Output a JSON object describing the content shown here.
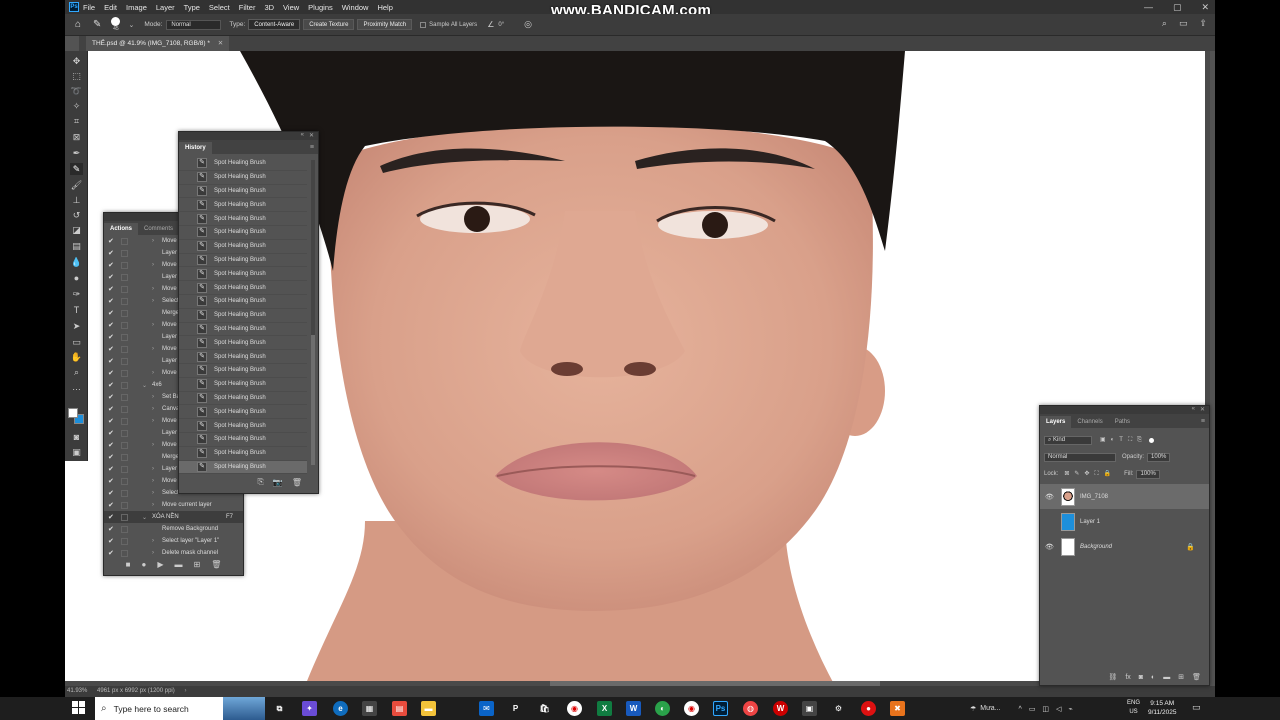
{
  "watermark": "www.BANDICAM.com",
  "menu": [
    "File",
    "Edit",
    "Image",
    "Layer",
    "Type",
    "Select",
    "Filter",
    "3D",
    "View",
    "Plugins",
    "Window",
    "Help"
  ],
  "options": {
    "brush_size": "45",
    "mode_label": "Mode:",
    "mode_value": "Normal",
    "type_label": "Type:",
    "type_buttons": [
      "Content-Aware",
      "Create Texture",
      "Proximity Match"
    ],
    "sample_all_layers": "Sample All Layers",
    "angle_value": "0°"
  },
  "document_tab": "THẺ.psd @ 41.9% (IMG_7108, RGB/8) *",
  "history": {
    "title": "History",
    "items": [
      "Spot Healing Brush",
      "Spot Healing Brush",
      "Spot Healing Brush",
      "Spot Healing Brush",
      "Spot Healing Brush",
      "Spot Healing Brush",
      "Spot Healing Brush",
      "Spot Healing Brush",
      "Spot Healing Brush",
      "Spot Healing Brush",
      "Spot Healing Brush",
      "Spot Healing Brush",
      "Spot Healing Brush",
      "Spot Healing Brush",
      "Spot Healing Brush",
      "Spot Healing Brush",
      "Spot Healing Brush",
      "Spot Healing Brush",
      "Spot Healing Brush",
      "Spot Healing Brush",
      "Spot Healing Brush",
      "Spot Healing Brush",
      "Spot Healing Brush"
    ]
  },
  "actions": {
    "tabs": [
      "Actions",
      "Comments"
    ],
    "rows": [
      {
        "label": "Move",
        "indent": 2,
        "tri": true
      },
      {
        "label": "Layer",
        "indent": 2,
        "tri": false
      },
      {
        "label": "Move",
        "indent": 2,
        "tri": true
      },
      {
        "label": "Layer",
        "indent": 2,
        "tri": false
      },
      {
        "label": "Move",
        "indent": 2,
        "tri": true
      },
      {
        "label": "Select",
        "indent": 2,
        "tri": true
      },
      {
        "label": "Merge",
        "indent": 2,
        "tri": false
      },
      {
        "label": "Move",
        "indent": 2,
        "tri": true
      },
      {
        "label": "Layer",
        "indent": 2,
        "tri": false
      },
      {
        "label": "Move",
        "indent": 2,
        "tri": true
      },
      {
        "label": "Layer",
        "indent": 2,
        "tri": false
      },
      {
        "label": "Move",
        "indent": 2,
        "tri": true
      },
      {
        "label": "4x6",
        "indent": 1,
        "tri": true,
        "open": true
      },
      {
        "label": "Set Ba",
        "indent": 2,
        "tri": true
      },
      {
        "label": "Canva",
        "indent": 2,
        "tri": true
      },
      {
        "label": "Move",
        "indent": 2,
        "tri": true
      },
      {
        "label": "Layer",
        "indent": 2,
        "tri": false
      },
      {
        "label": "Move",
        "indent": 2,
        "tri": true
      },
      {
        "label": "Merge",
        "indent": 2,
        "tri": false
      },
      {
        "label": "Layer",
        "indent": 2,
        "tri": true
      },
      {
        "label": "Move",
        "indent": 2,
        "tri": true
      },
      {
        "label": "Select",
        "indent": 2,
        "tri": true
      },
      {
        "label": "Move current layer",
        "indent": 2,
        "tri": true
      },
      {
        "label": "XÓA NỀN",
        "indent": 1,
        "tri": true,
        "open": true,
        "key": "F7",
        "sel": true
      },
      {
        "label": "Remove Background",
        "indent": 2,
        "tri": false
      },
      {
        "label": "Select layer \"Layer 1\"",
        "indent": 2,
        "tri": true
      },
      {
        "label": "Delete mask channel",
        "indent": 2,
        "tri": true
      }
    ]
  },
  "layers": {
    "tabs": [
      "Layers",
      "Channels",
      "Paths"
    ],
    "filter_kind": "Kind",
    "blend_mode": "Normal",
    "opacity_label": "Opacity:",
    "opacity_value": "100%",
    "lock_label": "Lock:",
    "fill_label": "Fill:",
    "fill_value": "100%",
    "items": [
      {
        "name": "IMG_7108",
        "visible": true,
        "selected": true,
        "thumb": "photo"
      },
      {
        "name": "Layer 1",
        "visible": false,
        "selected": false,
        "thumb": "#1d8fdb"
      },
      {
        "name": "Background",
        "visible": true,
        "selected": false,
        "thumb": "#ffffff",
        "italic": true,
        "locked": true
      }
    ]
  },
  "status": {
    "zoom": "41.93%",
    "doc_info": "4961 px x 6992 px (1200 ppi)"
  },
  "taskbar": {
    "search_placeholder": "Type here to search",
    "weather": "Mưa...",
    "lang1": "ENG",
    "lang2": "US",
    "time": "9:15 AM",
    "date": "9/11/2025"
  },
  "colors": {
    "foreground": "#ffffff",
    "background": "#1d8fdb",
    "ps_blue": "#31a8ff"
  }
}
